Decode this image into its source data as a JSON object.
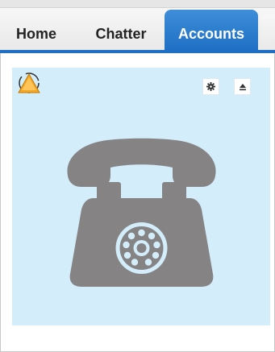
{
  "tabs": [
    {
      "label": "Home",
      "active": false
    },
    {
      "label": "Chatter",
      "active": false
    },
    {
      "label": "Accounts",
      "active": true
    }
  ],
  "colors": {
    "tab_active": "#1f6fc5",
    "panel_background": "#d3edfb",
    "phone_icon": "#858384",
    "alert_icon": "#f5a623"
  },
  "panel": {
    "status_icon": "alert-triangle-icon",
    "settings_button_icon": "gear-icon",
    "collapse_button_icon": "eject-icon",
    "main_icon": "telephone-icon"
  }
}
